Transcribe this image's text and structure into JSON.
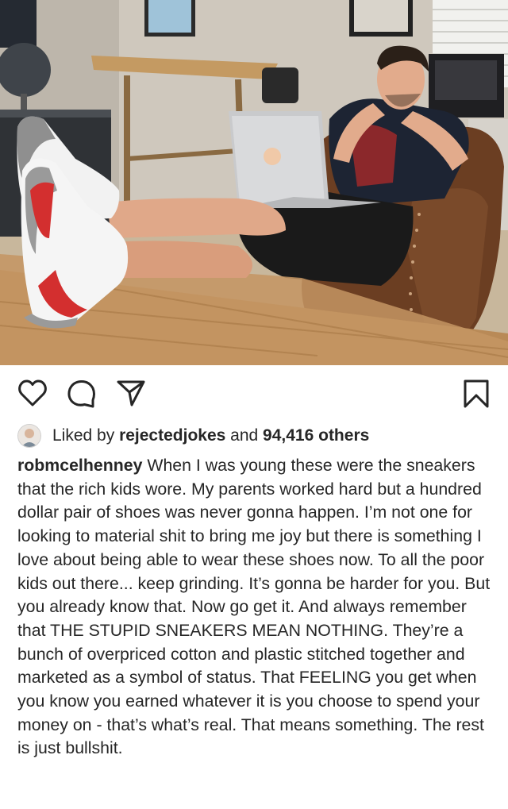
{
  "post": {
    "liked_prefix": "Liked by",
    "liked_user": "rejectedjokes",
    "liked_and": "and",
    "liked_others": "94,416 others",
    "author": "robmcelhenney",
    "caption": "When I was young these were the sneakers that the rich kids wore. My parents worked hard but a hundred dollar pair of shoes was never gonna happen. I’m not one for looking to material shit to bring me joy but there is something I love about being able to wear these shoes now. To all the poor kids out there... keep grinding. It’s gonna be harder for you. But you already know that. Now go get it. And always remember that THE STUPID SNEAKERS MEAN NOTHING. They’re a bunch of overpriced cotton and plastic stitched together and marketed as a symbol of status. That FEELING you get when you know you earned whatever it is you choose to spend your money on - that’s what’s real. That means something. The rest is just bullshit."
  },
  "icons": {
    "like": "heart-icon",
    "comment": "comment-icon",
    "share": "send-icon",
    "save": "bookmark-icon"
  },
  "colors": {
    "text": "#262626",
    "shoe_red": "#d32f2f",
    "chair_brown": "#6b3e22",
    "desk_wood": "#b98a57"
  }
}
